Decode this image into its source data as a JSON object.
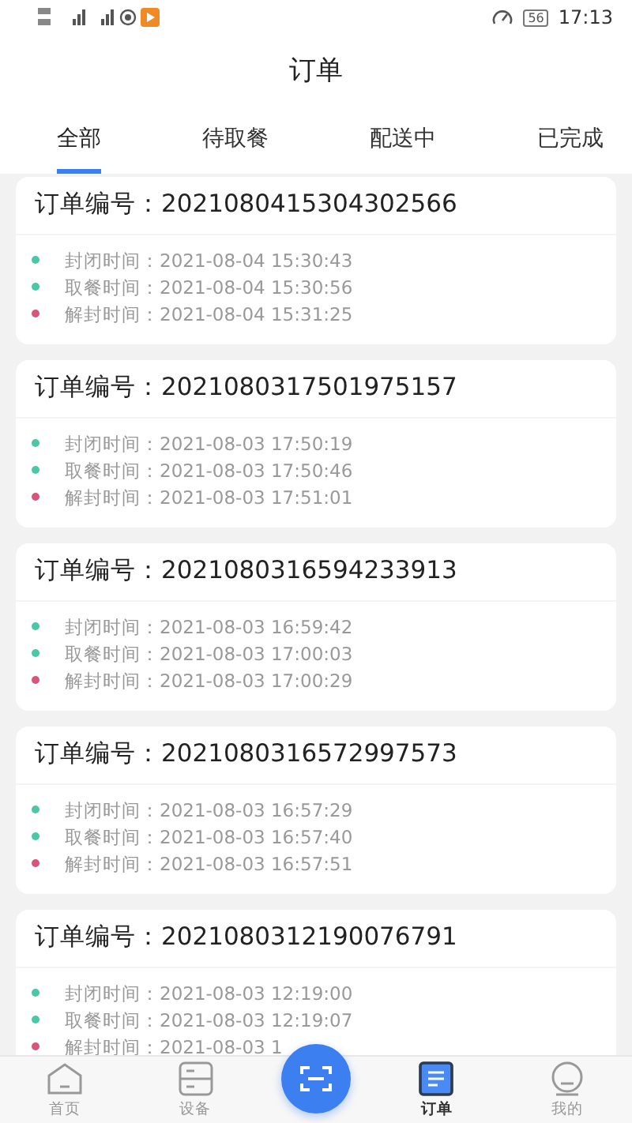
{
  "status_bar": {
    "time": "17:13",
    "battery": "56"
  },
  "header": {
    "title": "订单"
  },
  "tabs": [
    {
      "label": "全部",
      "selected": true
    },
    {
      "label": "待取餐",
      "selected": false
    },
    {
      "label": "配送中",
      "selected": false
    },
    {
      "label": "已完成",
      "selected": false
    }
  ],
  "orders": [
    {
      "number_label": "订单编号：",
      "number": "2021080415304302566",
      "events": [
        {
          "label": "封闭时间：",
          "time": "2021-08-04 15:30:43",
          "color": "#4cc7a5"
        },
        {
          "label": "取餐时间：",
          "time": "2021-08-04 15:30:56",
          "color": "#4cc7a5"
        },
        {
          "label": "解封时间：",
          "time": "2021-08-04 15:31:25",
          "color": "#d9547a"
        }
      ]
    },
    {
      "number_label": "订单编号：",
      "number": "2021080317501975157",
      "events": [
        {
          "label": "封闭时间：",
          "time": "2021-08-03 17:50:19",
          "color": "#4cc7a5"
        },
        {
          "label": "取餐时间：",
          "time": "2021-08-03 17:50:46",
          "color": "#4cc7a5"
        },
        {
          "label": "解封时间：",
          "time": "2021-08-03 17:51:01",
          "color": "#d9547a"
        }
      ]
    },
    {
      "number_label": "订单编号：",
      "number": "2021080316594233913",
      "events": [
        {
          "label": "封闭时间：",
          "time": "2021-08-03 16:59:42",
          "color": "#4cc7a5"
        },
        {
          "label": "取餐时间：",
          "time": "2021-08-03 17:00:03",
          "color": "#4cc7a5"
        },
        {
          "label": "解封时间：",
          "time": "2021-08-03 17:00:29",
          "color": "#d9547a"
        }
      ]
    },
    {
      "number_label": "订单编号：",
      "number": "2021080316572997573",
      "events": [
        {
          "label": "封闭时间：",
          "time": "2021-08-03 16:57:29",
          "color": "#4cc7a5"
        },
        {
          "label": "取餐时间：",
          "time": "2021-08-03 16:57:40",
          "color": "#4cc7a5"
        },
        {
          "label": "解封时间：",
          "time": "2021-08-03 16:57:51",
          "color": "#d9547a"
        }
      ]
    },
    {
      "number_label": "订单编号：",
      "number": "2021080312190076791",
      "events": [
        {
          "label": "封闭时间：",
          "time": "2021-08-03 12:19:00",
          "color": "#4cc7a5"
        },
        {
          "label": "取餐时间：",
          "time": "2021-08-03 12:19:07",
          "color": "#4cc7a5"
        },
        {
          "label": "解封时间：",
          "time": "2021-08-03 1",
          "color": "#d9547a"
        }
      ]
    }
  ],
  "nav": [
    {
      "kind": "home",
      "label": "首页",
      "selected": false
    },
    {
      "kind": "device",
      "label": "设备",
      "selected": false
    },
    {
      "kind": "scan"
    },
    {
      "kind": "orders",
      "label": "订单",
      "selected": true
    },
    {
      "kind": "profile",
      "label": "我的",
      "selected": false
    }
  ]
}
